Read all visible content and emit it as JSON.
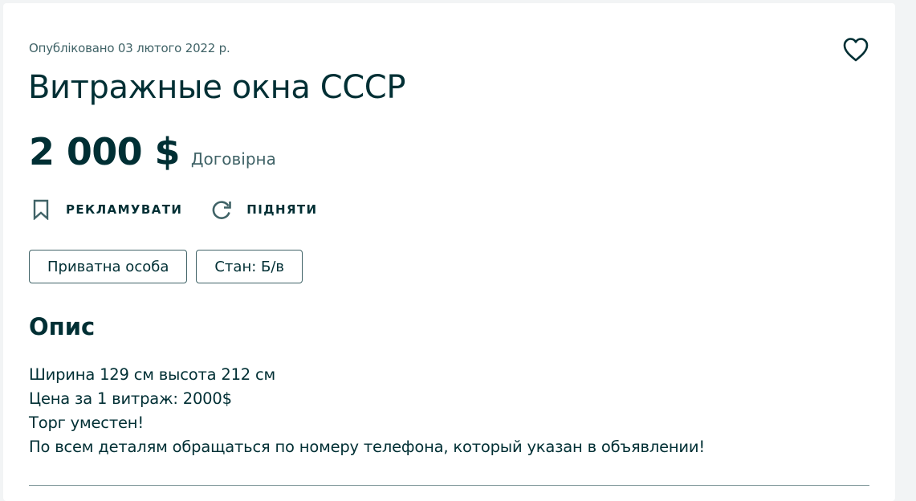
{
  "listing": {
    "posted": "Опубліковано 03 лютого 2022 р.",
    "title": "Витражные окна СССР",
    "price": "2 000 $",
    "price_note": "Договірна",
    "favorite_icon": "heart-outline-icon"
  },
  "actions": {
    "promote_label": "РЕКЛАМУВАТИ",
    "promote_icon": "bookmark-icon",
    "raise_label": "ПІДНЯТИ",
    "raise_icon": "refresh-icon"
  },
  "tags": [
    "Приватна особа",
    "Стан: Б/в"
  ],
  "description": {
    "heading": "Опис",
    "lines": [
      "Ширина 129 см высота 212 см",
      "Цена за 1 витраж: 2000$",
      "Торг уместен!",
      "По всем деталям обращаться по номеру телефона, который указан в объявлении!"
    ]
  },
  "colors": {
    "text": "#002f34",
    "muted": "#406367",
    "background": "#f2f4f5",
    "card": "#ffffff"
  }
}
